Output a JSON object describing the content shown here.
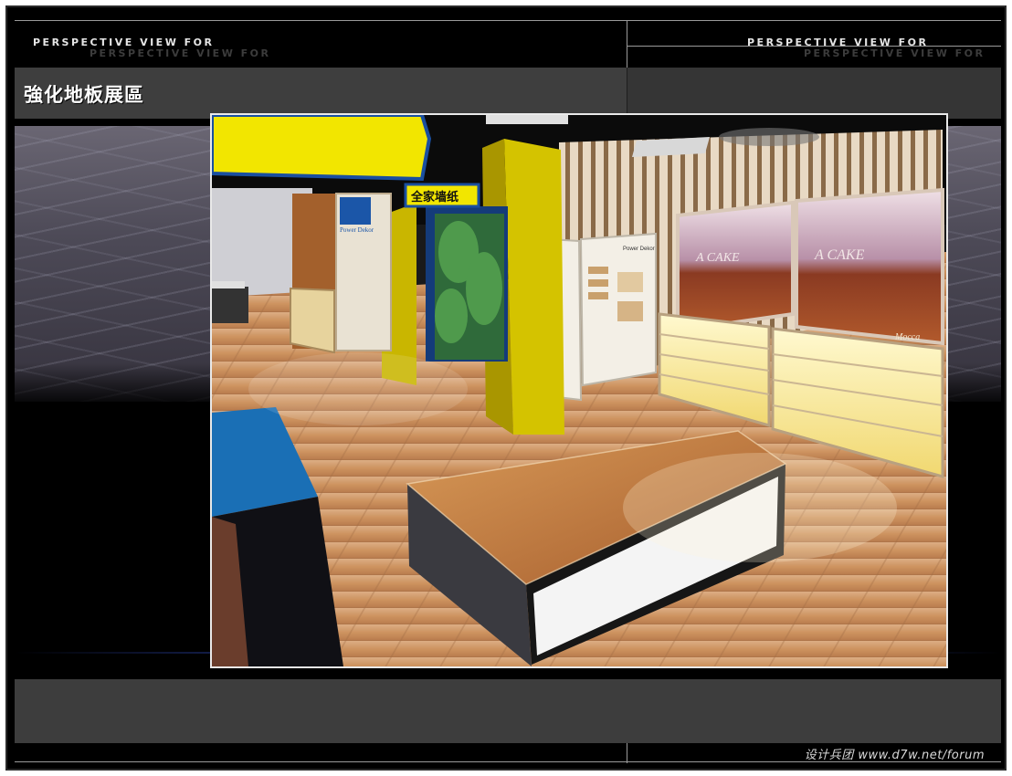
{
  "header": {
    "left_label": "PERSPECTIVE VIEW FOR",
    "right_label": "PERSPECTIVE VIEW FOR"
  },
  "title": "強化地板展區",
  "render": {
    "sign_text": "全家墙纸",
    "brand_logo_text": "Power Dekor",
    "panel_brand": "Power Dekor",
    "poster_text": "A CAKE",
    "poster_brand": "Mocca"
  },
  "footer": {
    "credit": "设计兵团 www.d7w.net/forum"
  },
  "colors": {
    "background": "#000000",
    "band": "#3d3d3d",
    "sign_yellow": "#f2e600",
    "booth_blue": "#1a6fb5",
    "wood": "#c98a52"
  }
}
